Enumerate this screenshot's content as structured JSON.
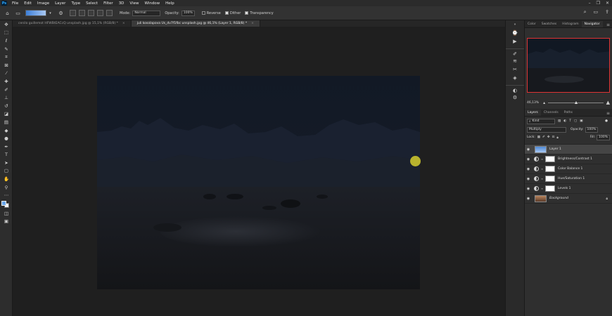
{
  "menubar": {
    "logo": "Ps",
    "items": [
      "File",
      "Edit",
      "Image",
      "Layer",
      "Type",
      "Select",
      "Filter",
      "3D",
      "View",
      "Window",
      "Help"
    ],
    "window_controls": [
      "–",
      "❐",
      "✕"
    ]
  },
  "options": {
    "mode_label": "Mode:",
    "mode_value": "Normal",
    "opacity_label": "Opacity:",
    "opacity_value": "100%",
    "reverse_label": "Reverse",
    "dither_label": "Dither",
    "transparency_label": "Transparency",
    "reverse_checked": false,
    "dither_checked": true,
    "transparency_checked": true
  },
  "tabs": [
    {
      "label": "cenilo guillemot HFWBtEACcQ unsplash.jpg @ 15,1% (RGB/8) *",
      "active": false
    },
    {
      "label": "juli kosolapova Us_dv7f1fbc unsplash.jpg @ 46,1% (Layer 1, RGB/8) *",
      "active": true
    }
  ],
  "panel_tabs": [
    "Color",
    "Swatches",
    "Histogram",
    "Navigator"
  ],
  "navigator": {
    "zoom": "46,13%"
  },
  "layers_tabs": [
    "Layers",
    "Channels",
    "Paths"
  ],
  "layers_controls": {
    "kind": "Kind",
    "blend_mode": "Multiply",
    "opacity_label": "Opacity:",
    "opacity": "100%",
    "lock_label": "Lock:",
    "fill_label": "Fill:",
    "fill": "100%"
  },
  "layers": [
    {
      "name": "Layer 1",
      "type": "pixel",
      "selected": true
    },
    {
      "name": "Brightness/Contrast 1",
      "type": "adjustment",
      "selected": false
    },
    {
      "name": "Color Balance 1",
      "type": "adjustment",
      "selected": false
    },
    {
      "name": "Hue/Saturation 1",
      "type": "adjustment",
      "selected": false
    },
    {
      "name": "Levels 1",
      "type": "adjustment",
      "selected": false
    },
    {
      "name": "Background",
      "type": "background",
      "selected": false
    }
  ],
  "colors": {
    "foreground": "#6aa7ea",
    "background": "#ffffff",
    "navigator_frame": "#dd3333"
  }
}
